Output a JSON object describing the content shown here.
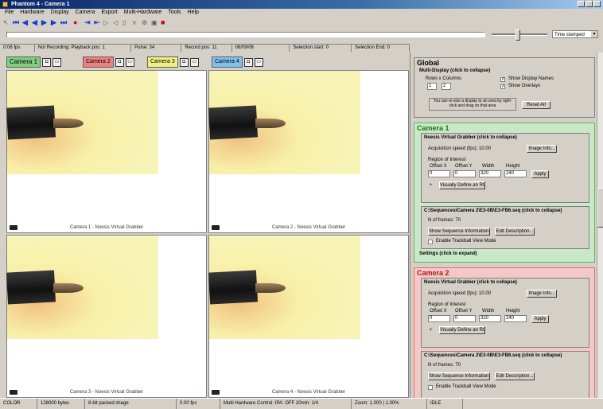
{
  "window": {
    "title": "Phantom 4 - Camera 1"
  },
  "menu": [
    "File",
    "Hardware",
    "Display",
    "Camera",
    "Export",
    "Multi-Hardware",
    "Tools",
    "Help"
  ],
  "toolbar_combo": "Time stamped",
  "status_top": [
    "0:08 fps",
    "Not Recording: Playback pos: 1",
    "Pulse: 34",
    "Record pos: 11",
    "08/09/08",
    "Selection start: 0",
    "Selection End: 0"
  ],
  "cams": [
    {
      "tab": "Camera 1",
      "color": "#7ed07e",
      "caption": "Camera 1 - Noesis Virtual Grabber"
    },
    {
      "tab": "Camera 2",
      "color": "#f08080",
      "caption": "Camera 2 - Noesis Virtual Grabber"
    },
    {
      "tab": "Camera 3",
      "color": "#f0f080",
      "caption": "Camera 3 - Noesis Virtual Grabber"
    },
    {
      "tab": "Camera 4",
      "color": "#80c0f0",
      "caption": "Camera 4 - Noesis Virtual Grabber"
    }
  ],
  "status_bottom": [
    "COLOR",
    "128000 bytes",
    "8-bit packed image",
    "0.00 fps",
    "Multi Hardware Control: IPA: OFF 20min: 1/4",
    "Zoom: 1.000 | 1.00%",
    "IDLE"
  ],
  "global": {
    "title": "Global",
    "sub": "Multi-Display (click to collapse)",
    "rows_label": "Rows x Columns",
    "rows": "1",
    "cols": "2",
    "show_display_names": "Show Display Names",
    "show_overlays": "Show Overlays",
    "note": "You can re-size a display to an area by right-click and drag on that area",
    "reset_button": "Reset All"
  },
  "camera1": {
    "title": "Camera 1",
    "sub": "Noesis Virtual Grabber (click to collapse)",
    "acq_label": "Acquisition speed (fps): 10.00",
    "image_info": "Image Info...",
    "roi_label": "Region of Interest",
    "roi_headers": [
      "Offset X",
      "Offset Y",
      "Width",
      "Height"
    ],
    "roi_values": [
      "0",
      "0",
      "320",
      "240"
    ],
    "apply": "Apply",
    "visually_define": "Visually Define an ROI",
    "seq_head": "C:\\Sequences\\Camera 2\\E3-0B\\E3-FB6.seq (click to collapse)",
    "frames": "N of frames: 70",
    "show_seq_info": "Show Sequence Information...",
    "edit_desc": "Edit Description...",
    "trackball": "Enable Trackball View Mode",
    "settings": "Settings (click to expand)"
  },
  "camera2": {
    "title": "Camera 2",
    "sub": "Noesis Virtual Grabber (click to collapse)",
    "acq_label": "Acquisition speed (fps): 10.00",
    "image_info": "Image Info...",
    "roi_label": "Region of Interest",
    "roi_headers": [
      "Offset X",
      "Offset Y",
      "Width",
      "Height"
    ],
    "roi_values": [
      "0",
      "0",
      "320",
      "240"
    ],
    "apply": "Apply",
    "visually_define": "Visually Define an ROI",
    "seq_head": "C:\\Sequences\\Camera 2\\E3-0B\\E3-FB6.seq (click to collapse)",
    "frames": "N of frames: 70",
    "show_seq_info": "Show Sequence Information...",
    "edit_desc": "Edit Description...",
    "trackball": "Enable Trackball View Mode"
  }
}
